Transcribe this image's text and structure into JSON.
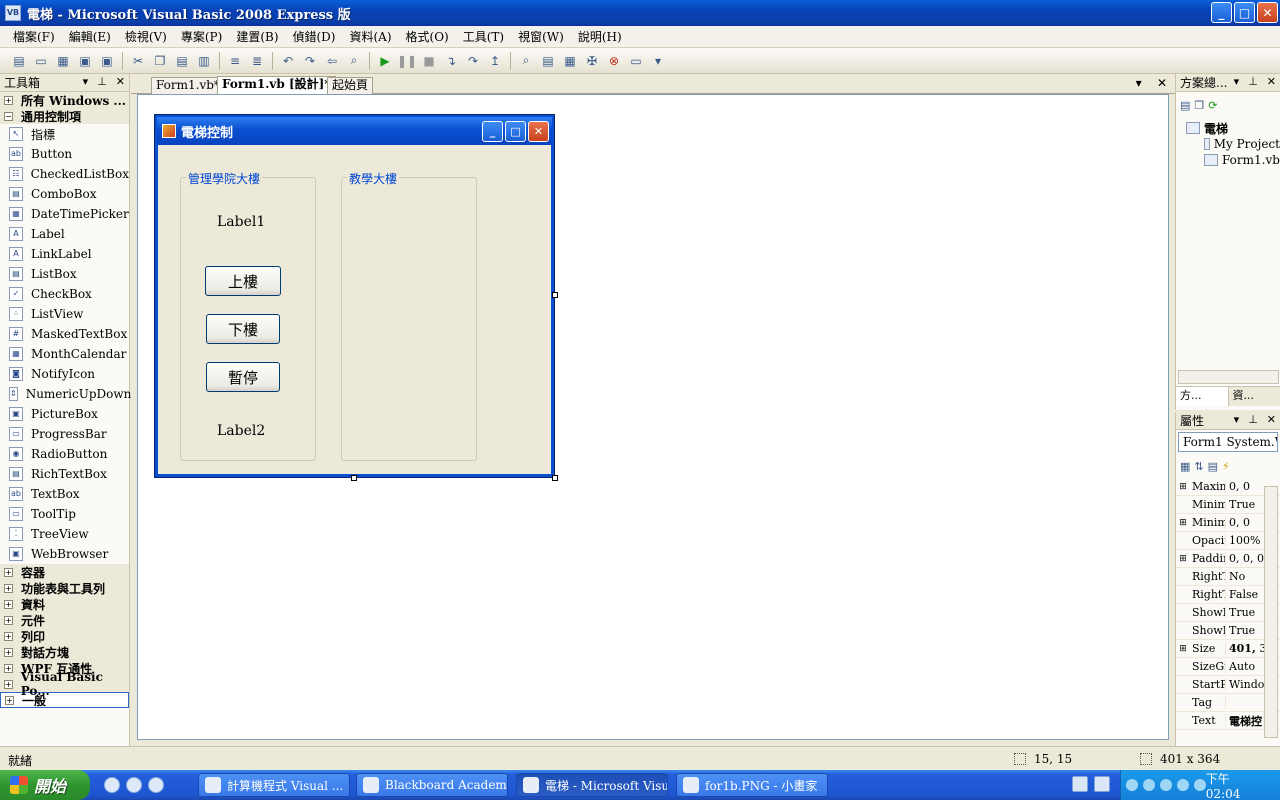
{
  "window": {
    "title": "電梯 - Microsoft Visual Basic 2008 Express 版",
    "app_icon": "VB"
  },
  "menu": [
    "檔案(F)",
    "編輯(E)",
    "檢視(V)",
    "專案(P)",
    "建置(B)",
    "偵錯(D)",
    "資料(A)",
    "格式(O)",
    "工具(T)",
    "視窗(W)",
    "說明(H)"
  ],
  "toolbox": {
    "title": "工具箱",
    "categories_top": [
      "所有 Windows ...",
      "通用控制項"
    ],
    "items": [
      "指標",
      "Button",
      "CheckedListBox",
      "ComboBox",
      "DateTimePicker",
      "Label",
      "LinkLabel",
      "ListBox",
      "CheckBox",
      "ListView",
      "MaskedTextBox",
      "MonthCalendar",
      "NotifyIcon",
      "NumericUpDown",
      "PictureBox",
      "ProgressBar",
      "RadioButton",
      "RichTextBox",
      "TextBox",
      "ToolTip",
      "TreeView",
      "WebBrowser"
    ],
    "item_icons": [
      "↖",
      "ab",
      "☷",
      "▤",
      "▦",
      "A",
      "A",
      "▤",
      "✓",
      "⁘",
      "#",
      "▦",
      "◙",
      "⇕",
      "▣",
      "▭",
      "◉",
      "▤",
      "ab",
      "▭",
      "⁚",
      "▣"
    ],
    "categories_bottom": [
      "容器",
      "功能表與工具列",
      "資料",
      "元件",
      "列印",
      "對話方塊",
      "WPF 互通性",
      "Visual Basic Po...",
      "一般"
    ]
  },
  "tabs": [
    {
      "label": "Form1.vb*",
      "active": false
    },
    {
      "label": "Form1.vb [設計]*",
      "active": true
    },
    {
      "label": "起始頁",
      "active": false
    }
  ],
  "form": {
    "title": "電梯控制",
    "group1_label": "管理學院大樓",
    "group2_label": "教學大樓",
    "label1": "Label1",
    "label2": "Label2",
    "btn_up": "上樓",
    "btn_down": "下樓",
    "btn_pause": "暫停"
  },
  "solution": {
    "title": "方案總...",
    "nodes": [
      "電梯",
      "My Project",
      "Form1.vb"
    ],
    "tab1": "方...",
    "tab2": "資..."
  },
  "properties": {
    "title": "屬性",
    "object": "Form1 System.W",
    "rows": [
      {
        "name": "Maxim",
        "value": "0, 0",
        "expand": true,
        "bold": false
      },
      {
        "name": "Minim",
        "value": "True",
        "expand": false,
        "bold": false
      },
      {
        "name": "Minim",
        "value": "0, 0",
        "expand": true,
        "bold": false
      },
      {
        "name": "Opacit",
        "value": "100%",
        "expand": false,
        "bold": false
      },
      {
        "name": "Paddin",
        "value": "0, 0, 0,",
        "expand": true,
        "bold": false
      },
      {
        "name": "RightT",
        "value": "No",
        "expand": false,
        "bold": false
      },
      {
        "name": "RightT",
        "value": "False",
        "expand": false,
        "bold": false
      },
      {
        "name": "ShowI",
        "value": "True",
        "expand": false,
        "bold": false
      },
      {
        "name": "ShowI",
        "value": "True",
        "expand": false,
        "bold": false
      },
      {
        "name": "Size",
        "value": "401, 3",
        "expand": true,
        "bold": true
      },
      {
        "name": "SizeGr",
        "value": "Auto",
        "expand": false,
        "bold": false
      },
      {
        "name": "StartPo",
        "value": "Window",
        "expand": false,
        "bold": false
      },
      {
        "name": "Tag",
        "value": "",
        "expand": false,
        "bold": false
      },
      {
        "name": "Text",
        "value": "電梯控",
        "expand": false,
        "bold": true
      }
    ]
  },
  "status": {
    "text": "就緒",
    "position": "15, 15",
    "size": "401 x 364"
  },
  "taskbar": {
    "start": "開始",
    "tasks": [
      "計算機程式 Visual ...",
      "Blackboard Academic ...",
      "電梯 - Microsoft Visu...",
      "for1b.PNG - 小畫家"
    ],
    "clock": "下午 02:04"
  }
}
